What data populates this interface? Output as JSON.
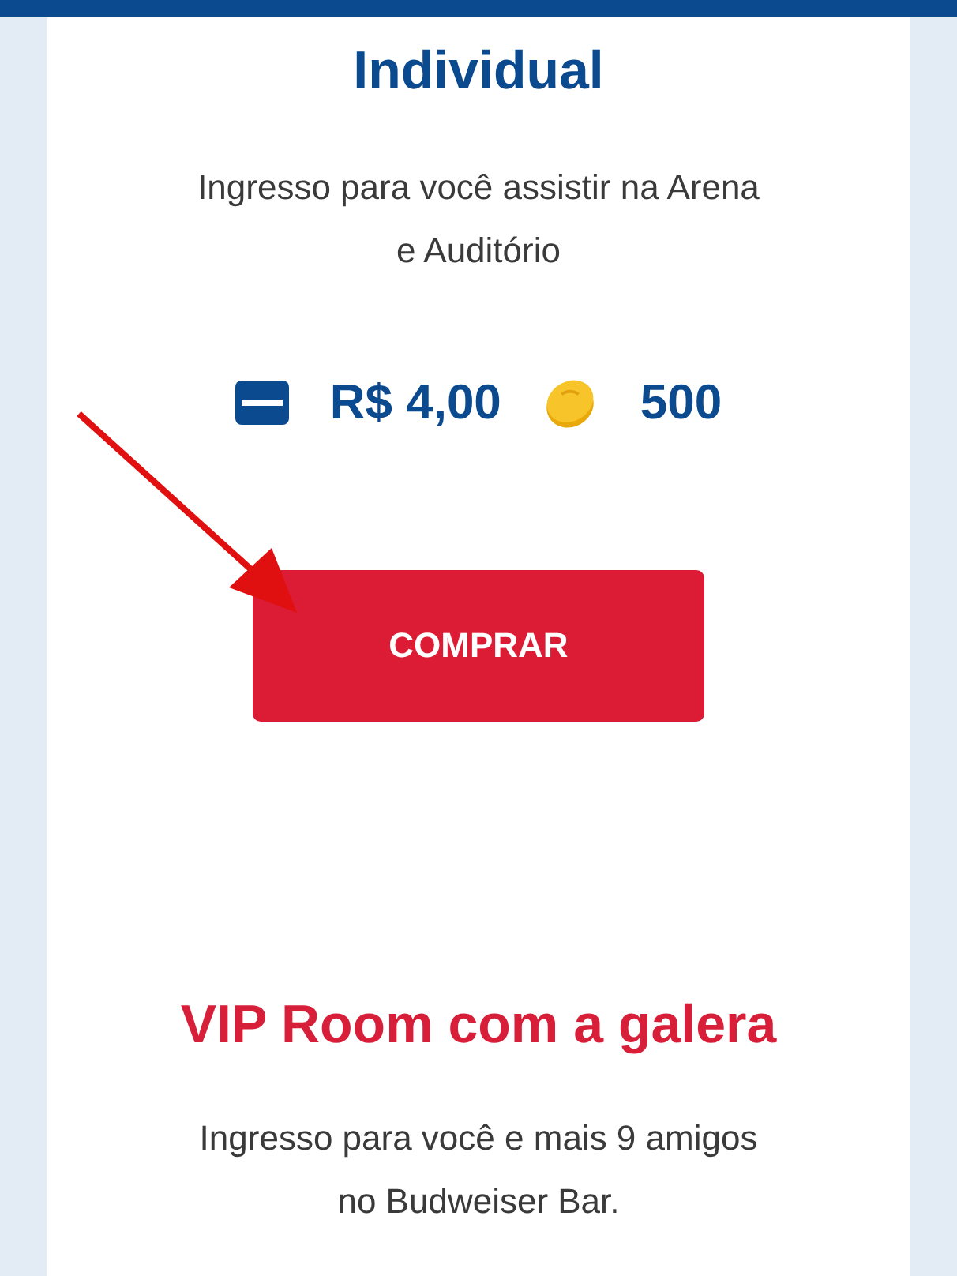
{
  "products": [
    {
      "title": "Individual",
      "kind": "primary",
      "description": "Ingresso para você assistir na Arena e Auditório",
      "price": "R$ 4,00",
      "coins": "500",
      "button": "COMPRAR"
    },
    {
      "title": "VIP Room com a galera",
      "kind": "accent",
      "description": "Ingresso para você e mais 9 amigos no Budweiser Bar."
    }
  ]
}
